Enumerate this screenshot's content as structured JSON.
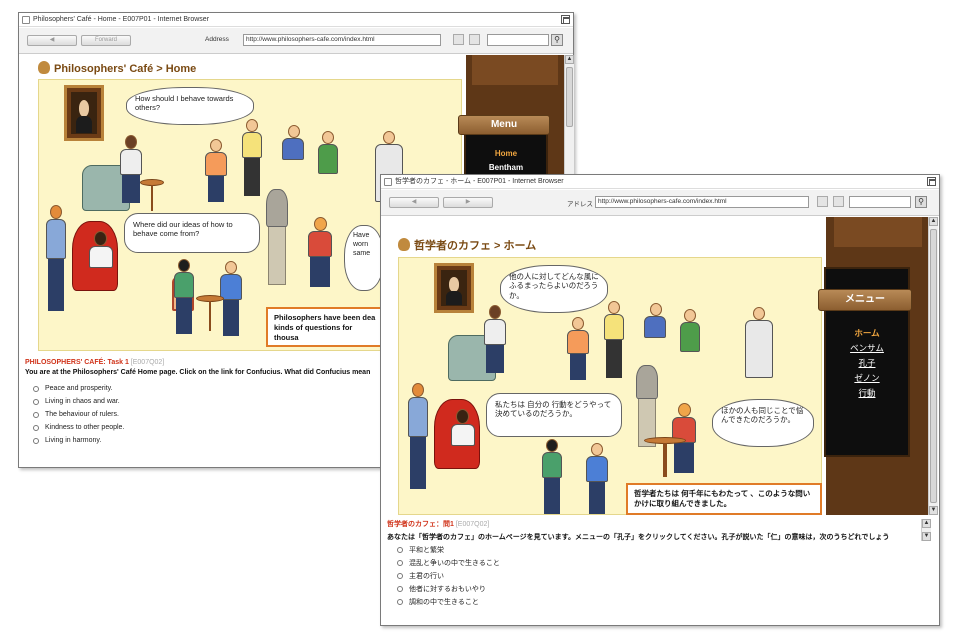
{
  "window_en": {
    "title": "Philosophers' Café - Home - E007P01 - Internet Browser",
    "nav_back": "",
    "nav_forward": "Forward",
    "address_label": "Address",
    "url": "http://www.philosophers-cafe.com/index.html",
    "page_title": "Philosophers' Café > Home",
    "menu_sign": "Menu",
    "menu_items": [
      "Home",
      "Bentham"
    ],
    "bubbles": {
      "top": "How should I behave towards others?",
      "middle": "Where did our ideas of how to behave come from?",
      "right_partial": "Have\nworn\nsame"
    },
    "callout": "Philosophers have been dea kinds of questions for thousa",
    "task": {
      "title": "PHILOSOPHERS' CAFÉ: Task 1",
      "code": "[E007Q02]",
      "prompt": "You are at the Philosophers' Café Home page. Click on the link for Confucius. What did Confucius mean",
      "options": [
        "Peace and prosperity.",
        "Living in chaos and war.",
        "The behaviour of rulers.",
        "Kindness to other people.",
        "Living in harmony."
      ]
    }
  },
  "window_ja": {
    "title": "哲学者のカフェ - ホーム - E007P01 - Internet Browser",
    "address_label": "アドレス",
    "url": "http://www.philosophers-cafe.com/index.html",
    "page_title": "哲学者のカフェ > ホーム",
    "menu_sign": "メニュー",
    "menu_items": [
      "ホーム",
      "ベンサム",
      "孔子",
      "ゼノン",
      "行動"
    ],
    "bubbles": {
      "top": "他の人に対してどんな風にふるまったらよいのだろうか。",
      "middle": "私たちは 自分の 行動をどうやって 決めているのだろうか。",
      "right": "ほかの人も同じことで悩んできたのだろうか。"
    },
    "callout": "哲学者たちは 何千年にもわたって 、このような問いかけに取り組んできました。",
    "task": {
      "title": "哲学者のカフェ：問1",
      "code": "[E007Q02]",
      "prompt": "あなたは「哲学者のカフェ」のホームページを見ています。メニューの「孔子」をクリックしてください。孔子が説いた「仁」の意味は，次のうちどれでしょう",
      "options": [
        "平和と繁栄",
        "混乱と争いの中で生きること",
        "主君の行い",
        "他者に対するおもいやり",
        "調和の中で生きること"
      ]
    }
  },
  "colors": {
    "task_title": "#d0331a",
    "menu_active": "#f0a640",
    "callout_border": "#e07b28",
    "page_title": "#7a4a13"
  }
}
